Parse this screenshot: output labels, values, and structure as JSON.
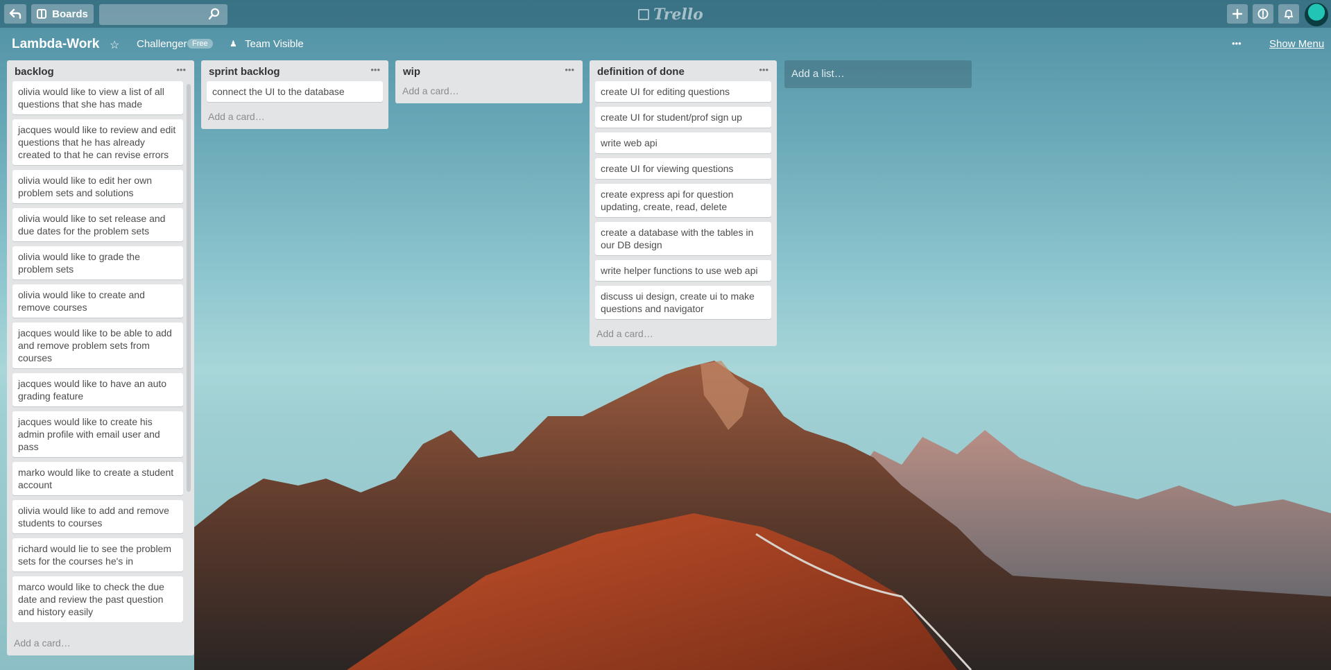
{
  "header": {
    "boards_label": "Boards",
    "logo_text": "Trello",
    "icons": [
      "back-arrow-icon",
      "boards-icon",
      "search-icon",
      "plus-icon",
      "info-icon",
      "bell-icon"
    ]
  },
  "board": {
    "title": "Lambda-Work",
    "team": "Challenger",
    "plan_badge": "Free",
    "visibility": "Team Visible",
    "show_menu": "Show Menu"
  },
  "lists": [
    {
      "title": "backlog",
      "cards": [
        "olivia would like to view a list of all questions that she has made",
        "jacques would like to review and edit questions that he has already created to that he can revise errors",
        "olivia would like to edit her own problem sets and solutions",
        "olivia would like to set release and due dates for the problem sets",
        "olivia would like to grade the problem sets",
        "olivia would like to create and remove courses",
        "jacques would like to be able to add and remove problem sets from courses",
        "jacques would like to have an auto grading feature",
        "jacques would like to create his admin profile with email user and pass",
        "marko would like to create a student account",
        "olivia would like to add and remove students to courses",
        "richard would lie to see the problem sets for the courses he's in",
        "marco would like to check the due date and review the past question and history easily"
      ],
      "add_card": "Add a card…"
    },
    {
      "title": "sprint backlog",
      "cards": [
        "connect the UI to the database"
      ],
      "add_card": "Add a card…"
    },
    {
      "title": "wip",
      "cards": [],
      "add_card": "Add a card…"
    },
    {
      "title": "definition of done",
      "cards": [
        "create UI for editing questions",
        "create UI for student/prof sign up",
        "write web api",
        "create UI for viewing questions",
        "create express api for question updating, create, read, delete",
        "create a database with the tables in our DB design",
        "write helper functions to use web api",
        "discuss ui design, create ui to make questions and navigator"
      ],
      "add_card": "Add a card…"
    }
  ],
  "add_list": "Add a list…",
  "colors": {
    "header_bg": "#3d7a8c",
    "list_bg": "#e2e4e6",
    "card_bg": "#ffffff"
  }
}
